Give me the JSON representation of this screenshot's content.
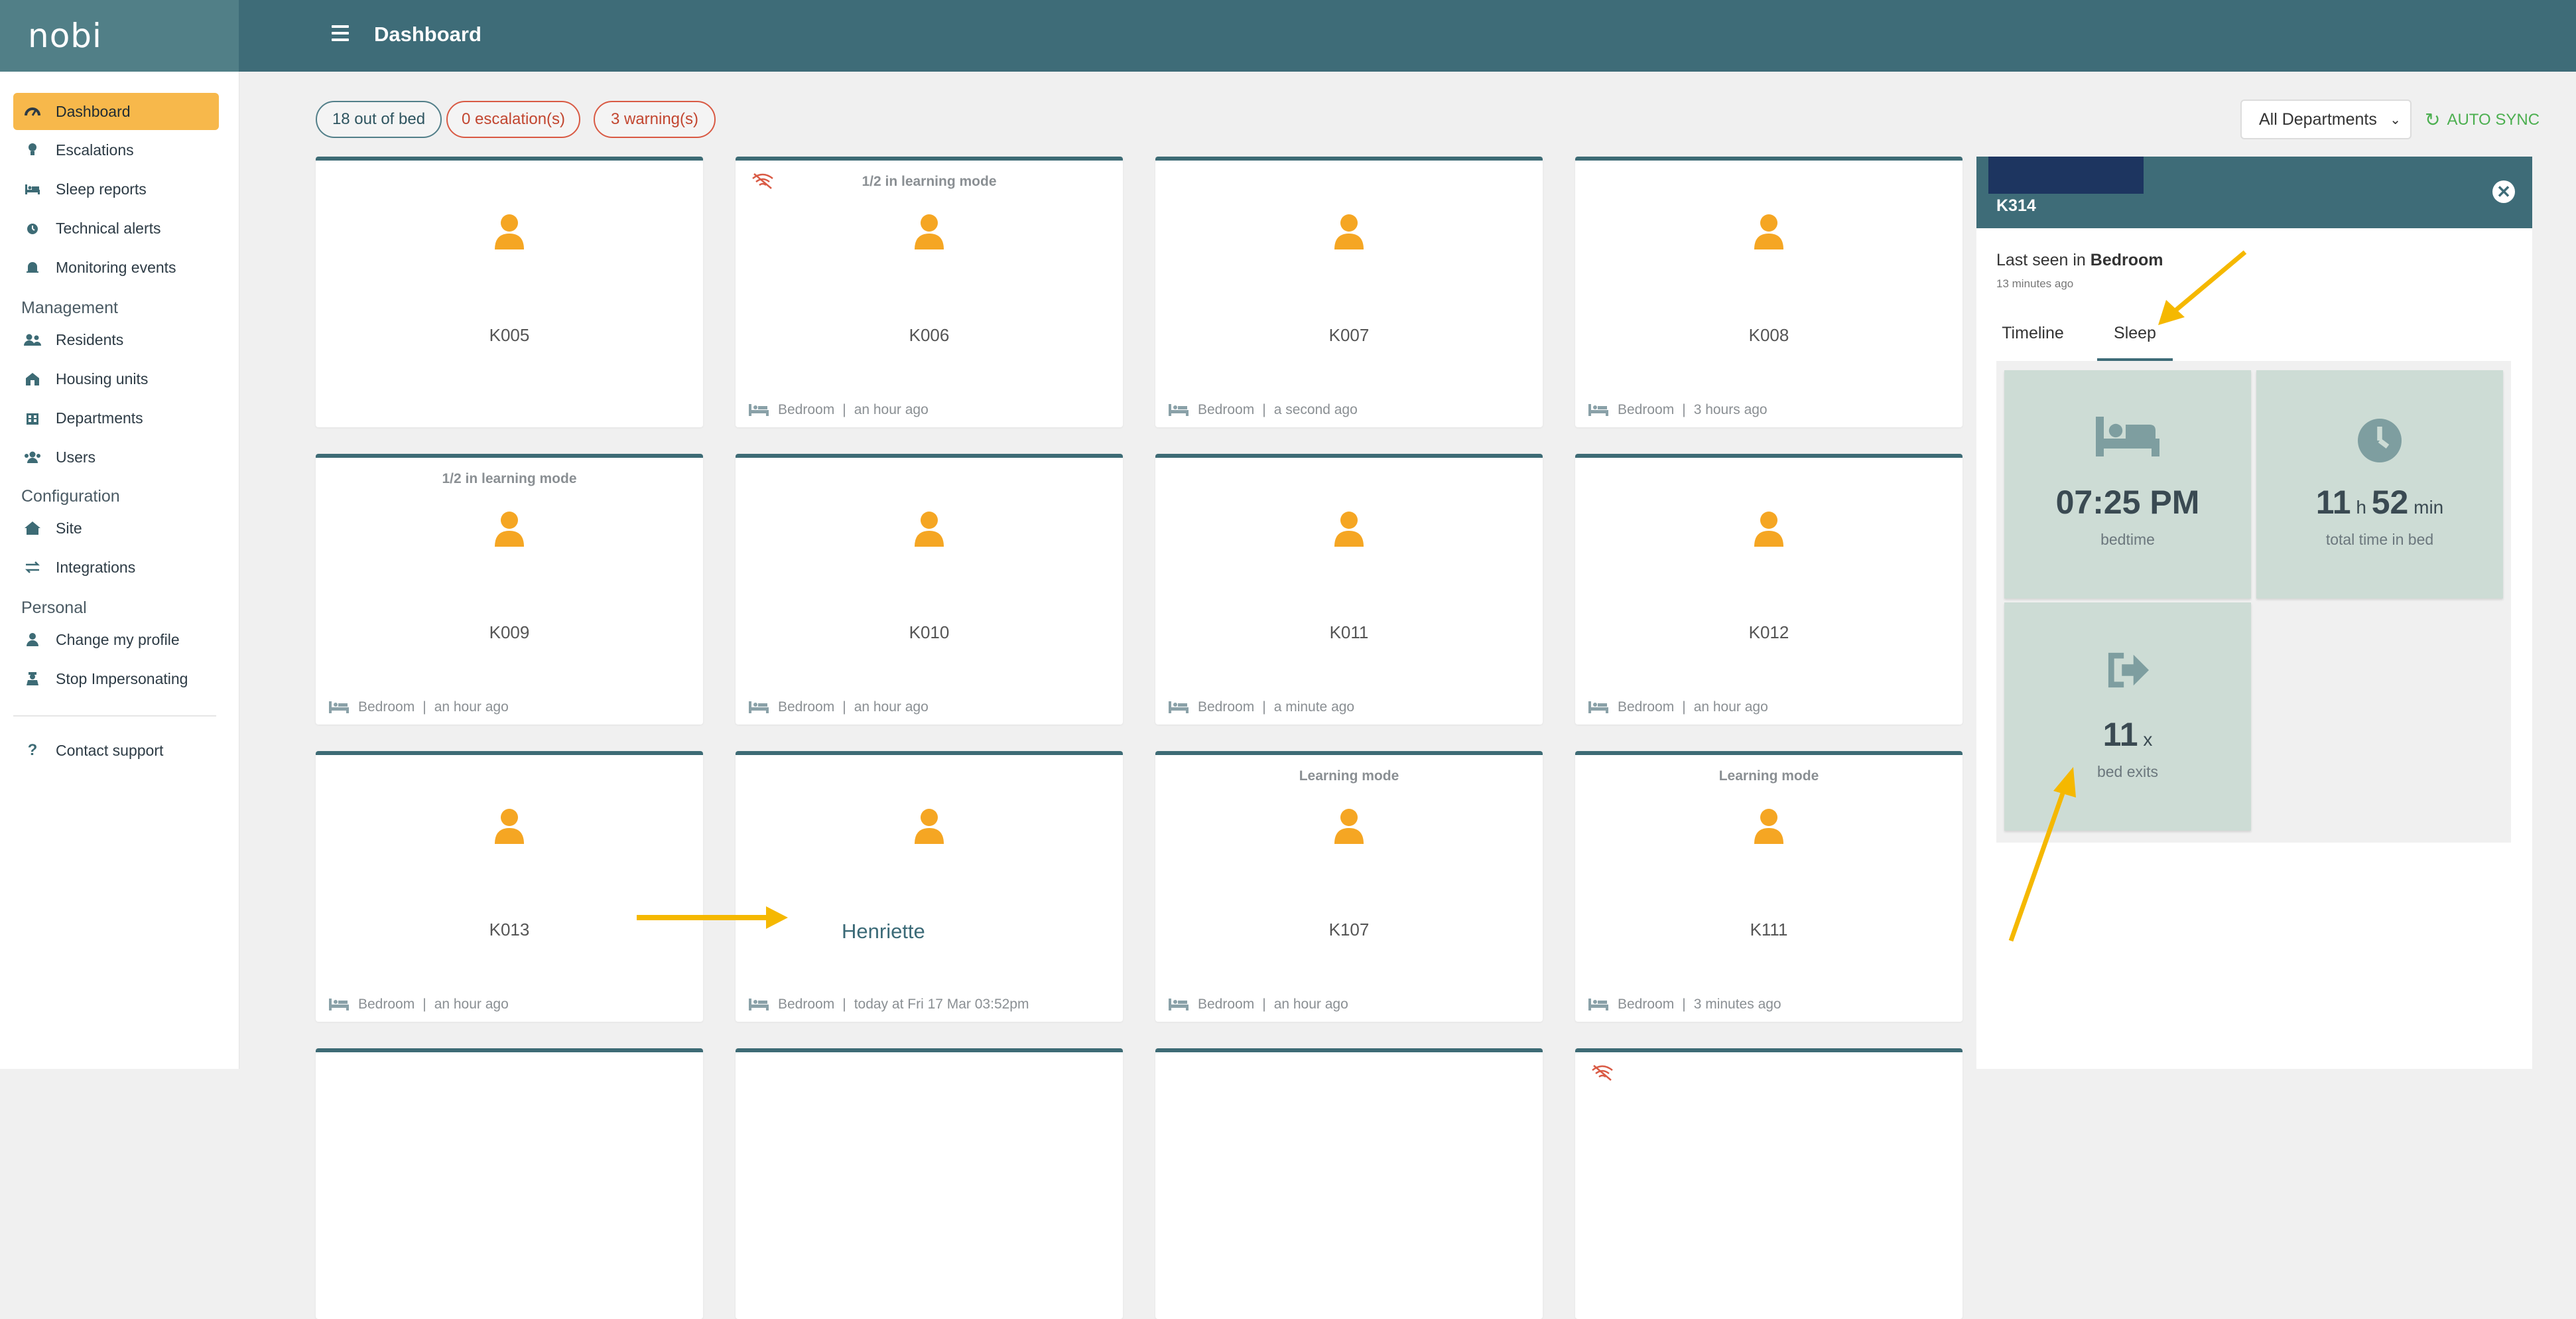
{
  "app": {
    "logo": "nobi"
  },
  "header": {
    "title": "Dashboard"
  },
  "sidebar": {
    "items": [
      {
        "label": "Dashboard",
        "icon": "gauge-icon",
        "glyph": "◐"
      },
      {
        "label": "Escalations",
        "icon": "lightbulb-icon",
        "glyph": "❢"
      },
      {
        "label": "Sleep reports",
        "icon": "bed-icon",
        "glyph": "▬"
      },
      {
        "label": "Technical alerts",
        "icon": "alarm-icon",
        "glyph": "⏰"
      },
      {
        "label": "Monitoring events",
        "icon": "bell-icon",
        "glyph": "🔔"
      }
    ],
    "management_label": "Management",
    "management": [
      {
        "label": "Residents",
        "icon": "users-icon",
        "glyph": "👥"
      },
      {
        "label": "Housing units",
        "icon": "building-icon",
        "glyph": "⌂"
      },
      {
        "label": "Departments",
        "icon": "departments-icon",
        "glyph": "▦"
      },
      {
        "label": "Users",
        "icon": "users-group-icon",
        "glyph": "👥"
      }
    ],
    "configuration_label": "Configuration",
    "configuration": [
      {
        "label": "Site",
        "icon": "home-icon",
        "glyph": "⌂"
      },
      {
        "label": "Integrations",
        "icon": "exchange-icon",
        "glyph": "⇄"
      }
    ],
    "personal_label": "Personal",
    "personal": [
      {
        "label": "Change my profile",
        "icon": "user-icon",
        "glyph": "👤"
      },
      {
        "label": "Stop Impersonating",
        "icon": "user-secret-icon",
        "glyph": "👤"
      }
    ],
    "support": {
      "label": "Contact support",
      "icon": "question-icon",
      "glyph": "?"
    }
  },
  "status": {
    "out_of_bed": "18 out of bed",
    "escalations": "0 escalation(s)",
    "warnings": "3 warning(s)"
  },
  "filters": {
    "department": "All Departments",
    "autosync": "AUTO SYNC"
  },
  "cards": [
    {
      "room": "K005",
      "status": "",
      "location": "",
      "time": "",
      "wifi_off": false
    },
    {
      "room": "K006",
      "status": "1/2 in learning mode",
      "location": "Bedroom",
      "time": "an hour ago",
      "wifi_off": true
    },
    {
      "room": "K007",
      "status": "",
      "location": "Bedroom",
      "time": "a second ago",
      "wifi_off": false
    },
    {
      "room": "K008",
      "status": "",
      "location": "Bedroom",
      "time": "3 hours ago",
      "wifi_off": false
    },
    {
      "room": "K009",
      "status": "1/2 in learning mode",
      "location": "Bedroom",
      "time": "an hour ago",
      "wifi_off": false
    },
    {
      "room": "K010",
      "status": "",
      "location": "Bedroom",
      "time": "an hour ago",
      "wifi_off": false
    },
    {
      "room": "K011",
      "status": "",
      "location": "Bedroom",
      "time": "a minute ago",
      "wifi_off": false
    },
    {
      "room": "K012",
      "status": "",
      "location": "Bedroom",
      "time": "an hour ago",
      "wifi_off": false
    },
    {
      "room": "K013",
      "status": "",
      "location": "Bedroom",
      "time": "an hour ago",
      "wifi_off": false
    },
    {
      "room": "Henriette",
      "status": "",
      "location": "Bedroom",
      "time": "today at Fri 17 Mar 03:52pm",
      "wifi_off": false
    },
    {
      "room": "K107",
      "status": "Learning mode",
      "location": "Bedroom",
      "time": "an hour ago",
      "wifi_off": false
    },
    {
      "room": "K111",
      "status": "Learning mode",
      "location": "Bedroom",
      "time": "3 minutes ago",
      "wifi_off": false
    },
    {
      "room": "",
      "status": "",
      "location": "",
      "time": "",
      "wifi_off": false
    },
    {
      "room": "",
      "status": "",
      "location": "",
      "time": "",
      "wifi_off": false
    },
    {
      "room": "",
      "status": "",
      "location": "",
      "time": "",
      "wifi_off": false
    },
    {
      "room": "",
      "status": "",
      "location": "",
      "time": "",
      "wifi_off": true
    }
  ],
  "panel": {
    "room": "K314",
    "last_seen_prefix": "Last seen in",
    "last_seen_location": "Bedroom",
    "last_seen_ago": "13 minutes ago",
    "tabs": {
      "timeline": "Timeline",
      "sleep": "Sleep"
    },
    "active_tab": "Sleep",
    "bedtime": {
      "value": "07:25 PM",
      "label": "bedtime"
    },
    "total_time": {
      "hours": "11",
      "h_unit": "h",
      "minutes": "52",
      "min_unit": "min",
      "label": "total time in bed"
    },
    "bed_exits": {
      "value": "11",
      "unit": "x",
      "label": "bed exits"
    }
  },
  "colors": {
    "primary": "#3e6c78",
    "accent": "#f7b84b",
    "avatar": "#f5a623",
    "tile": "#cddcd5",
    "danger": "#d95a44",
    "sync": "#4caf50",
    "annotation_arrow": "#f5b800"
  }
}
